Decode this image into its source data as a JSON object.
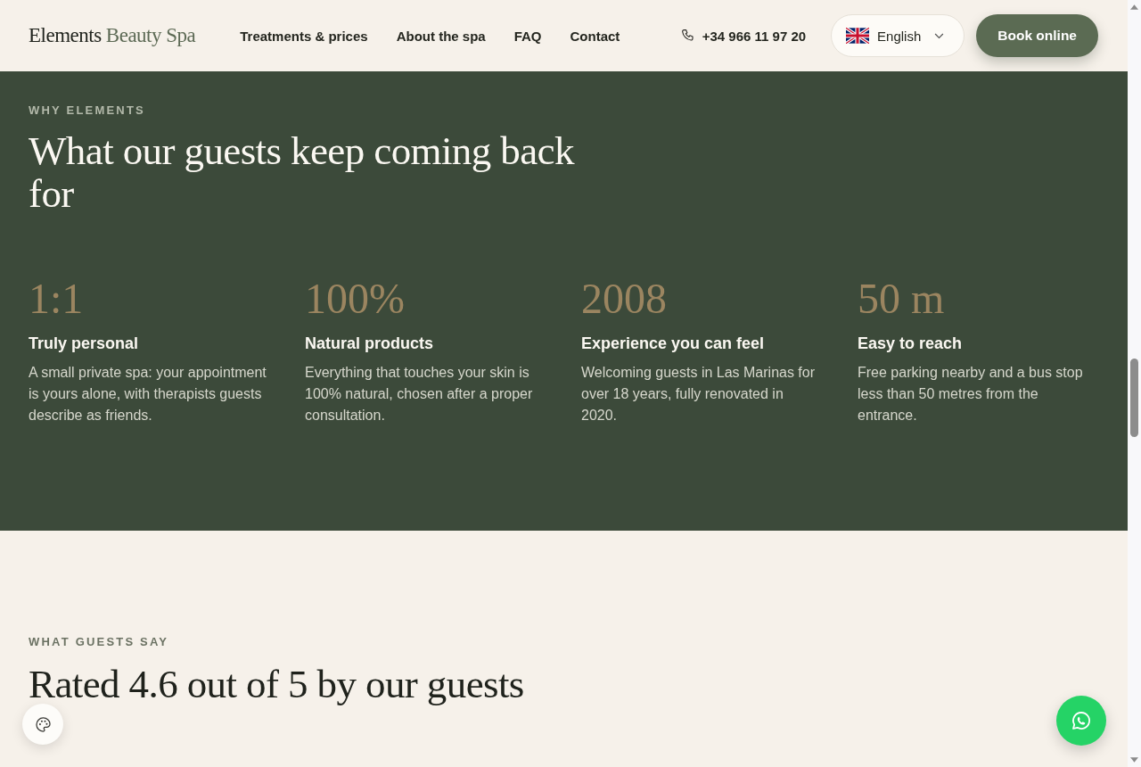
{
  "header": {
    "logo": {
      "primary": "Elements",
      "secondary": "Beauty Spa"
    },
    "nav": [
      "Treatments & prices",
      "About the spa",
      "FAQ",
      "Contact"
    ],
    "phone": "+34 966 11 97 20",
    "language": "English",
    "cta": "Book online"
  },
  "why_section": {
    "eyebrow": "WHY ELEMENTS",
    "heading": "What our guests keep coming back for",
    "stats": [
      {
        "value": "1:1",
        "title": "Truly personal",
        "description": "A small private spa: your appointment is yours alone, with therapists guests describe as friends."
      },
      {
        "value": "100%",
        "title": "Natural products",
        "description": "Everything that touches your skin is 100% natural, chosen after a proper consultation."
      },
      {
        "value": "2008",
        "title": "Experience you can feel",
        "description": "Welcoming guests in Las Marinas for over 18 years, fully renovated in 2020."
      },
      {
        "value": "50 m",
        "title": "Easy to reach",
        "description": "Free parking nearby and a bus stop less than 50 metres from the entrance."
      }
    ]
  },
  "reviews_section": {
    "eyebrow": "WHAT GUESTS SAY",
    "heading": "Rated 4.6 out of 5 by our guests"
  }
}
